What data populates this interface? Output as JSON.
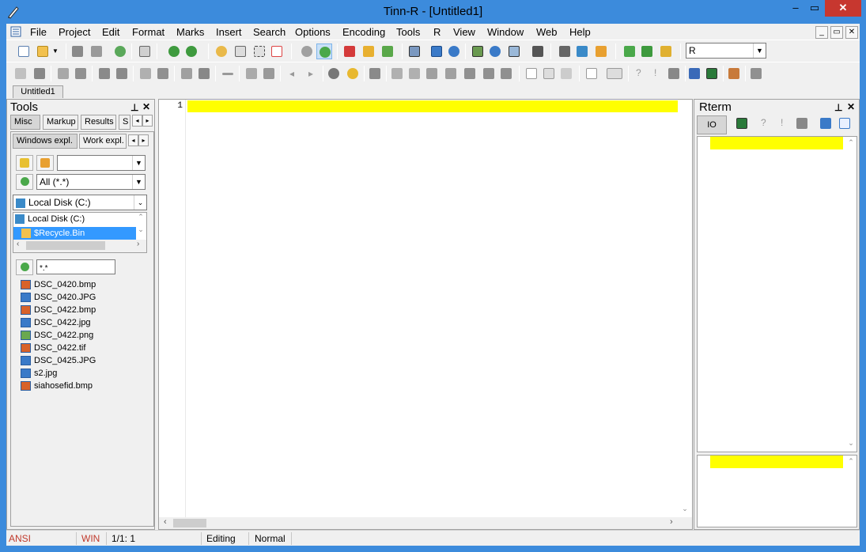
{
  "window": {
    "title": "Tinn-R - [Untitled1]",
    "min": "–",
    "max": "▭",
    "close": "✕"
  },
  "menu": [
    "File",
    "Project",
    "Edit",
    "Format",
    "Marks",
    "Insert",
    "Search",
    "Options",
    "Encoding",
    "Tools",
    "R",
    "View",
    "Window",
    "Web",
    "Help"
  ],
  "mdi": {
    "min": "_",
    "restore": "▭",
    "close": "✕"
  },
  "toolbar": {
    "interpreter_select": "R"
  },
  "doc_tabs": [
    "Untitled1"
  ],
  "tools_panel": {
    "title": "Tools",
    "tabs": [
      "Misc",
      "Markup",
      "Results",
      "S"
    ],
    "subtabs": [
      "Windows expl.",
      "Work expl."
    ],
    "filter_select": "All (*.*)",
    "drive_select": "Local Disk (C:)",
    "tree": [
      "Local Disk (C:)",
      "$Recycle.Bin"
    ],
    "file_filter": "*.*",
    "files": [
      "DSC_0420.bmp",
      "DSC_0420.JPG",
      "DSC_0422.bmp",
      "DSC_0422.jpg",
      "DSC_0422.png",
      "DSC_0422.tif",
      "DSC_0425.JPG",
      "s2.jpg",
      "siahosefid.bmp"
    ],
    "file_icon_colors": [
      "#d8622a",
      "#3a7ac8",
      "#d8622a",
      "#3a7ac8",
      "#6aa84f",
      "#d8622a",
      "#3a7ac8",
      "#3a7ac8",
      "#d8622a"
    ]
  },
  "editor": {
    "line_numbers": [
      "1"
    ]
  },
  "rterm_panel": {
    "title": "Rterm",
    "tab": "IO"
  },
  "status": {
    "encoding": "ANSI",
    "eol": "WIN",
    "position": "1/1: 1",
    "mode": "Editing",
    "insert": "Normal"
  },
  "colors": {
    "titlebar": "#3c8bdc",
    "highlight": "#ffff00",
    "close": "#c7372f",
    "selection": "#3399ff"
  }
}
